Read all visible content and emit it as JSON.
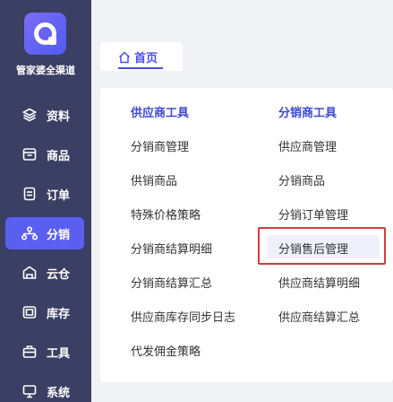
{
  "app": {
    "name": "管家婆全渠道"
  },
  "sidebar": {
    "items": [
      {
        "label": "资料",
        "icon": "layers-icon",
        "active": false
      },
      {
        "label": "商品",
        "icon": "box-icon",
        "active": false
      },
      {
        "label": "订单",
        "icon": "document-icon",
        "active": false
      },
      {
        "label": "分销",
        "icon": "distribution-icon",
        "active": true
      },
      {
        "label": "云仓",
        "icon": "warehouse-icon",
        "active": false
      },
      {
        "label": "库存",
        "icon": "inventory-icon",
        "active": false
      },
      {
        "label": "工具",
        "icon": "toolbox-icon",
        "active": false
      },
      {
        "label": "系统",
        "icon": "monitor-icon",
        "active": false
      }
    ]
  },
  "tabs": [
    {
      "label": "首页",
      "icon": "home-icon"
    }
  ],
  "menu": {
    "supplier_tools": {
      "title": "供应商工具",
      "links": [
        "分销商管理",
        "供销商品",
        "特殊价格策略",
        "分销商结算明细",
        "分销商结算汇总",
        "供应商库存同步日志",
        "代发佣金策略"
      ]
    },
    "distributor_tools": {
      "title": "分销商工具",
      "links": [
        "供应商管理",
        "分销商品",
        "分销订单管理",
        "分销售后管理",
        "供应商结算明细",
        "供应商结算汇总"
      ]
    }
  },
  "colors": {
    "sidebar": "#3a3f63",
    "accent": "#5b5ff0",
    "highlight_border": "#d9383a"
  }
}
